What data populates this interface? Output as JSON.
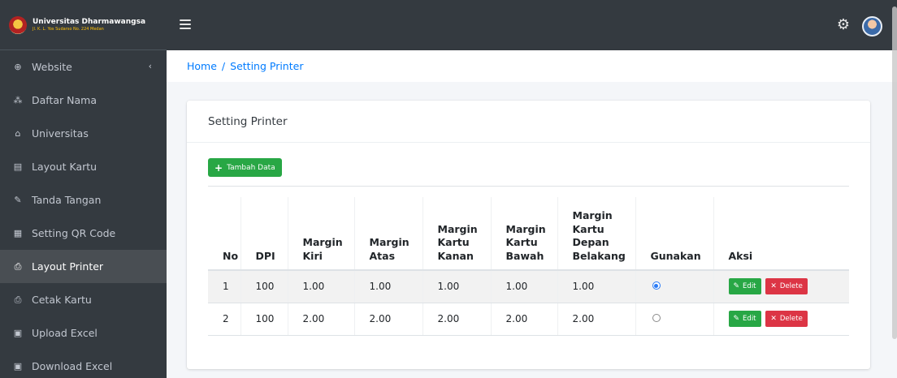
{
  "brand": {
    "title": "Universitas Dharmawangsa",
    "subtitle": "Jl. K. L. Yos Sudarso No. 224 Medan"
  },
  "sidebar": {
    "items": [
      {
        "label": "Website",
        "icon": "globe-icon",
        "glyph": "⊕",
        "caret": "‹"
      },
      {
        "label": "Daftar Nama",
        "icon": "users-icon",
        "glyph": "⁂"
      },
      {
        "label": "Universitas",
        "icon": "university-icon",
        "glyph": "⌂"
      },
      {
        "label": "Layout Kartu",
        "icon": "id-card-icon",
        "glyph": "▤"
      },
      {
        "label": "Tanda Tangan",
        "icon": "signature-icon",
        "glyph": "✎"
      },
      {
        "label": "Setting QR Code",
        "icon": "qrcode-icon",
        "glyph": "▦"
      },
      {
        "label": "Layout Printer",
        "icon": "printer-icon",
        "glyph": "⎙",
        "active": true
      },
      {
        "label": "Cetak Kartu",
        "icon": "printer-icon",
        "glyph": "⎙"
      },
      {
        "label": "Upload Excel",
        "icon": "excel-file-icon",
        "glyph": "▣"
      },
      {
        "label": "Download Excel",
        "icon": "excel-file-icon",
        "glyph": "▣"
      }
    ]
  },
  "topbar": {
    "settings_glyph": "⚙"
  },
  "breadcrumb": {
    "home": "Home",
    "separator": "/",
    "current": "Setting Printer"
  },
  "card": {
    "title": "Setting Printer",
    "add_button": "Tambah Data",
    "add_glyph": "+"
  },
  "table": {
    "headers": [
      "No",
      "DPI",
      "Margin Kiri",
      "Margin Atas",
      "Margin Kartu Kanan",
      "Margin Kartu Bawah",
      "Margin Kartu Depan Belakang",
      "Gunakan",
      "Aksi"
    ],
    "rows": [
      {
        "no": "1",
        "dpi": "100",
        "kiri": "1.00",
        "atas": "1.00",
        "kanan": "1.00",
        "bawah": "1.00",
        "depan_belakang": "1.00",
        "gunakan": true
      },
      {
        "no": "2",
        "dpi": "100",
        "kiri": "2.00",
        "atas": "2.00",
        "kanan": "2.00",
        "bawah": "2.00",
        "depan_belakang": "2.00",
        "gunakan": false
      }
    ],
    "edit_label": "Edit",
    "delete_label": "Delete"
  },
  "colors": {
    "sidebar_bg": "#343a40",
    "active_item_bg": "#494e53",
    "link": "#007bff",
    "success": "#28a745",
    "danger": "#dc3545"
  }
}
